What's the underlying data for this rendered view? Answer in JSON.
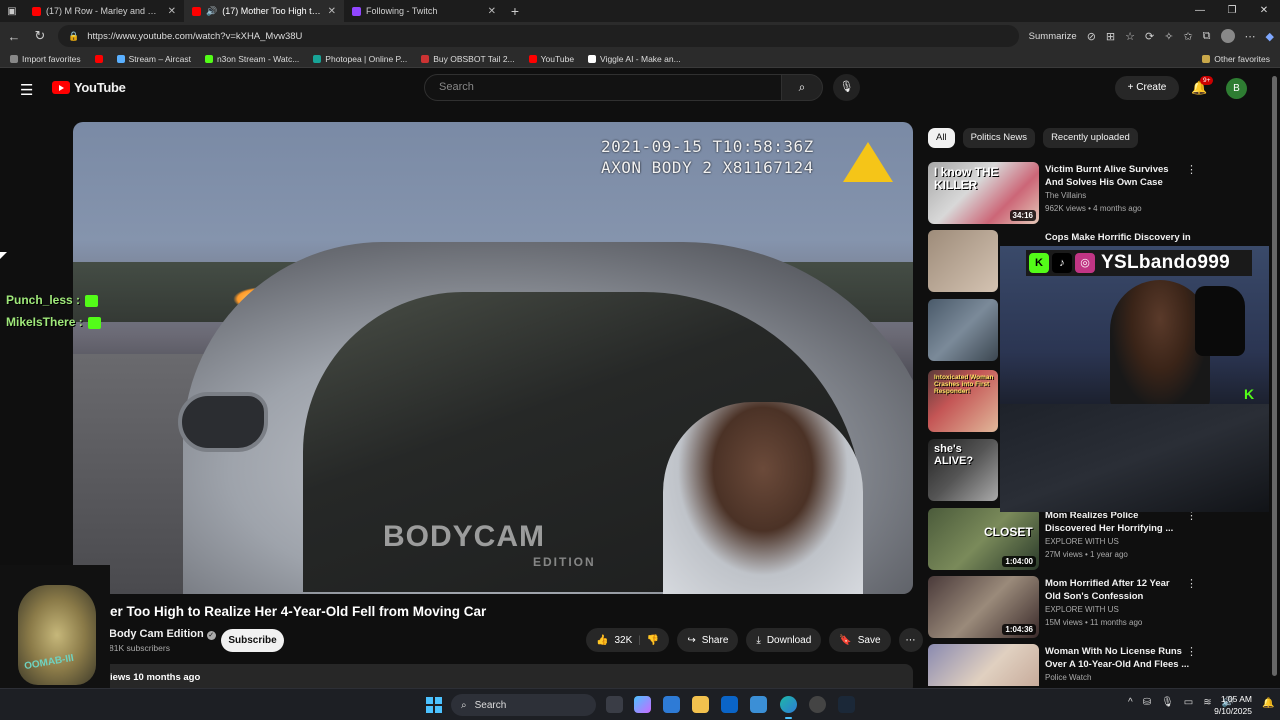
{
  "browser": {
    "tabs": [
      {
        "title": "(17) M Row - Marley and Mike (C",
        "favicon": "youtube",
        "active": false
      },
      {
        "title": "(17) Mother Too High to Rea",
        "favicon": "youtube",
        "active": true
      },
      {
        "title": "Following - Twitch",
        "favicon": "twitch",
        "active": false
      }
    ],
    "url": "https://www.youtube.com/watch?v=kXHA_Mvw38U",
    "summarize_label": "Summarize",
    "bookmarks": [
      {
        "label": "Import favorites",
        "color": "#888888"
      },
      {
        "label": "",
        "color": "#ff0000"
      },
      {
        "label": "Stream – Aircast",
        "color": "#5ab0ff"
      },
      {
        "label": "n3on Stream - Watc...",
        "color": "#53fc18"
      },
      {
        "label": "Photopea | Online P...",
        "color": "#18a497"
      },
      {
        "label": "Buy OBSBOT Tail 2...",
        "color": "#cc3333"
      },
      {
        "label": "YouTube",
        "color": "#ff0000"
      },
      {
        "label": "Viggle AI - Make an...",
        "color": "#ffffff"
      }
    ],
    "other_favorites": "Other favorites"
  },
  "youtube": {
    "logo_text": "YouTube",
    "search_placeholder": "Search",
    "create_label": "Create",
    "notification_count": "9+",
    "user_initial": "B"
  },
  "video": {
    "timestamp_line1": "2021-09-15 T10:58:36Z",
    "timestamp_line2": "AXON BODY 2 X81167124",
    "watermark": "BODYCAM",
    "watermark_sub": "EDITION",
    "title": "er Too High to Realize Her 4-Year-Old Fell from Moving Car",
    "channel": "Body Cam Edition",
    "subscribers": "81K subscribers",
    "subscribe_label": "Subscribe",
    "likes": "32K",
    "share_label": "Share",
    "download_label": "Download",
    "save_label": "Save",
    "views_text": "iews  10 months ago"
  },
  "chips": [
    {
      "label": "All",
      "active": true
    },
    {
      "label": "Politics News",
      "active": false
    },
    {
      "label": "Recently uploaded",
      "active": false
    }
  ],
  "recommendations": [
    {
      "title": "Victim Burnt Alive Survives And Solves His Own Case",
      "channel": "The Villains",
      "meta": "962K views • 4 months ago",
      "duration": "34:16",
      "thumb_text": "I know THE KILLER"
    },
    {
      "title": "Cops Make Horrific Discovery in",
      "channel": "",
      "meta": "",
      "duration": "",
      "thumb_text": ""
    },
    {
      "title": "",
      "channel": "",
      "meta": "",
      "duration": "",
      "thumb_text": ""
    },
    {
      "title": "",
      "channel": "",
      "meta": "",
      "duration": "",
      "thumb_text": "Intoxicated Woman Crashes into First Responder!"
    },
    {
      "title": "",
      "channel": "",
      "meta": "",
      "duration": "",
      "thumb_text": "she's ALIVE?"
    },
    {
      "title": "Mom Realizes Police Discovered Her Horrifying ...",
      "channel": "EXPLORE WITH US",
      "meta": "27M views • 1 year ago",
      "duration": "1:04:00",
      "thumb_text": "CLOSET"
    },
    {
      "title": "Mom Horrified After 12 Year Old Son's Confession",
      "channel": "EXPLORE WITH US",
      "meta": "15M views • 11 months ago",
      "duration": "1:04:36",
      "thumb_text": ""
    },
    {
      "title": "Woman With No License Runs Over A 10-Year-Old And Flees ...",
      "channel": "Police Watch",
      "meta": "",
      "duration": "",
      "thumb_text": ""
    }
  ],
  "overlay": {
    "handle": "YSLbando999",
    "chat": [
      {
        "user": "Punch_less :"
      },
      {
        "user": "MikeIsThere :"
      }
    ],
    "logo_text": "OOMAB-III"
  },
  "taskbar": {
    "search_label": "Search",
    "time": "1:05 AM",
    "date": "9/10/2025"
  }
}
